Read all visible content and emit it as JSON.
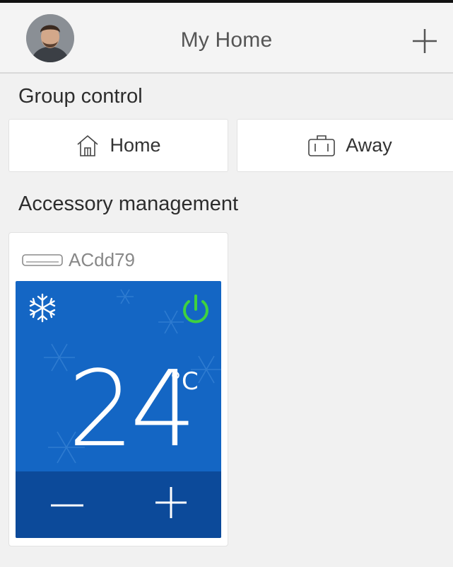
{
  "header": {
    "title": "My Home",
    "add_icon": "plus-icon",
    "avatar": "user-avatar"
  },
  "group_control": {
    "title": "Group control",
    "buttons": [
      {
        "label": "Home",
        "icon": "home-icon"
      },
      {
        "label": "Away",
        "icon": "suitcase-icon"
      }
    ]
  },
  "accessory_management": {
    "title": "Accessory management",
    "devices": [
      {
        "name": "ACdd79",
        "device_icon": "air-conditioner-icon",
        "mode_icon": "snowflake-icon",
        "power_icon": "power-icon",
        "power_color": "#3fd23f",
        "temperature": "24",
        "unit": "°C",
        "decrease_icon": "minus-icon",
        "increase_icon": "plus-icon"
      }
    ]
  },
  "colors": {
    "panel": "#1466c4",
    "panel_bottom": "#0c4a9a",
    "background": "#f1f1f1"
  }
}
